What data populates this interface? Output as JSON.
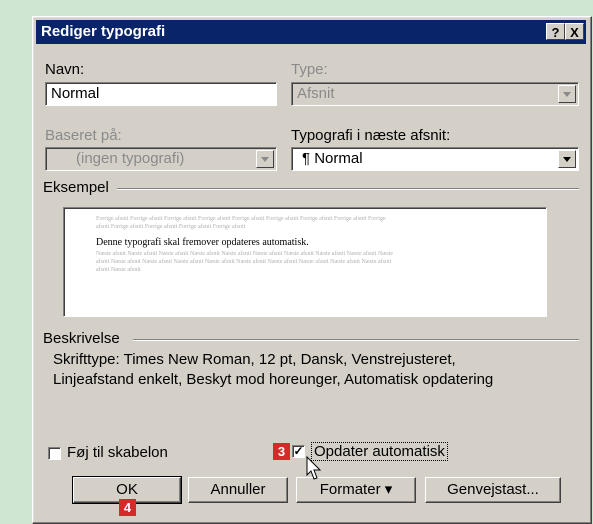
{
  "dialog": {
    "title": "Rediger typografi",
    "help_btn": "?",
    "close_btn": "X"
  },
  "navn": {
    "label": "Navn:",
    "value": "Normal"
  },
  "type": {
    "label": "Type:",
    "value": "Afsnit"
  },
  "baseret": {
    "label": "Baseret på:",
    "value": "(ingen typografi)"
  },
  "naeste": {
    "label": "Typografi i næste afsnit:",
    "value": "¶ Normal"
  },
  "eksempel": {
    "label": "Eksempel",
    "gray_line_1": "Forrige afsnit Forrige afsnit Forrige afsnit Forrige afsnit Forrige afsnit Forrige afsnit Forrige afsnit Forrige afsnit Forrige",
    "gray_line_2": "afsnit Forrige afsnit Forrige afsnit Forrige afsnit Forrige afsnit",
    "main_text": "Denne typografi skal fremover opdateres automatisk.",
    "after_line_1": "Næste afsnit Næste afsnit Næste afsnit Næste afsnit Næste afsnit Næste afsnit Næste afsnit Næste afsnit Næste afsnit Næste",
    "after_line_2": "afsnit Næste afsnit Næste afsnit Næste afsnit Næste afsnit Næste afsnit Næste afsnit Næste afsnit Næste afsnit Næste afsnit",
    "after_line_3": "afsnit Næste afsnit"
  },
  "beskrivelse": {
    "label": "Beskrivelse",
    "line1": "Skrifttype: Times New Roman, 12 pt, Dansk, Venstrejusteret,",
    "line2": "Linjeafstand enkelt, Beskyt mod horeunger, Automatisk opdatering"
  },
  "checkboxes": {
    "skabelon": {
      "label": "Føj til skabelon",
      "checked": false,
      "mark": ""
    },
    "opdater": {
      "label": "Opdater automatisk",
      "checked": true,
      "mark": "✓"
    }
  },
  "buttons": {
    "ok": "OK",
    "annuller": "Annuller",
    "formater": "Formater ▾",
    "genvejstast": "Genvejstast..."
  },
  "badges": {
    "step3": "3",
    "step4": "4"
  },
  "colors": {
    "titlebar": "#0a246a",
    "badge": "#d62a2a",
    "background": "#cfe6d3"
  }
}
